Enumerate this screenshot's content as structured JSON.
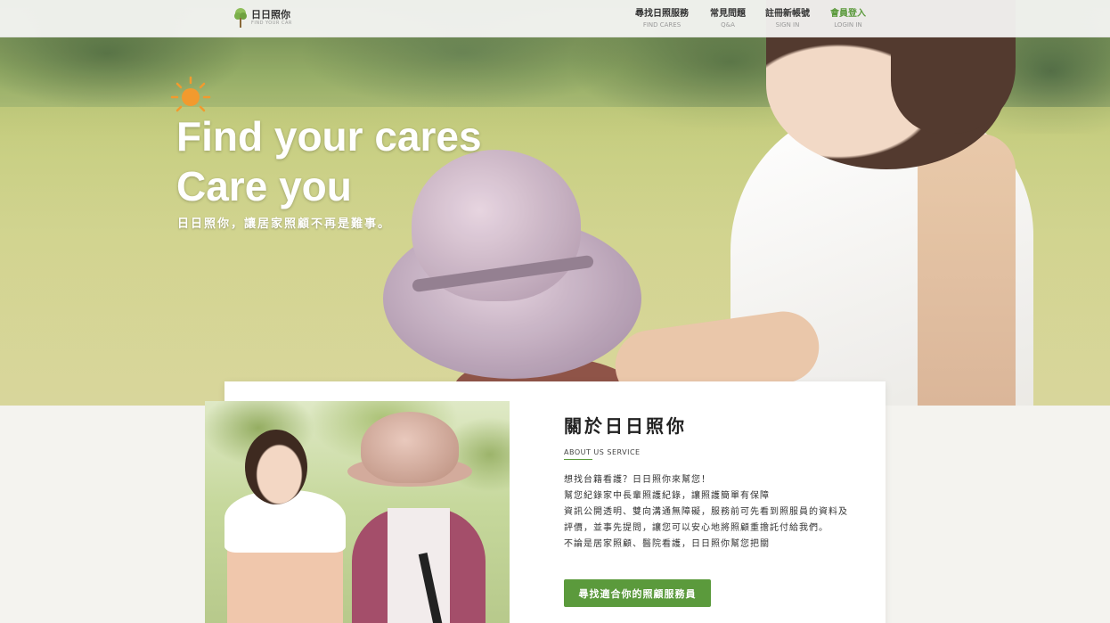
{
  "brand": {
    "name": "日日照你",
    "tagline": "FIND YOUR CAR"
  },
  "nav": [
    {
      "zh": "尋找日照服務",
      "en": "FIND CARES"
    },
    {
      "zh": "常見問題",
      "en": "Q&A"
    },
    {
      "zh": "註冊新帳號",
      "en": "SIGN IN"
    },
    {
      "zh": "會員登入",
      "en": "LOGIN IN"
    }
  ],
  "hero": {
    "title_line1": "Find your cares",
    "title_line2": "Care you",
    "subtitle": "日日照你，讓居家照顧不再是難事。"
  },
  "about": {
    "title": "關於日日照你",
    "subtitle_en": "ABOUT US SERVICE",
    "paragraphs": [
      "想找台籍看護？日日照你來幫您！",
      "幫您紀錄家中長輩照護紀錄，讓照護簡單有保障",
      "資訊公開透明、雙向溝通無障礙，服務前可先看到照服員的資料及",
      "評價，並事先提問，讓您可以安心地將照顧重擔託付給我們。",
      "不論是居家照顧、醫院看護，日日照你幫您把關"
    ],
    "cta_label": "尋找適合你的照顧服務員"
  },
  "colors": {
    "accent": "#5b9a3c",
    "sun": "#f29a2e"
  },
  "icons": {
    "logo": "tree-icon",
    "hero": "sun-icon"
  }
}
